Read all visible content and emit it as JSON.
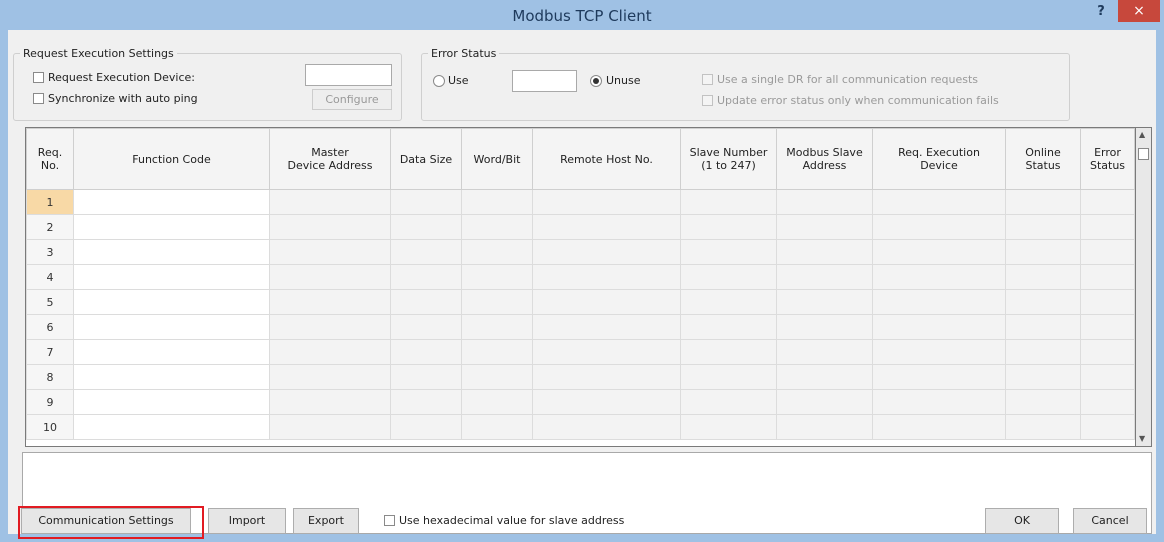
{
  "window": {
    "title": "Modbus TCP Client",
    "help": "?",
    "close": "×"
  },
  "request_settings": {
    "legend": "Request Execution Settings",
    "device_label": "Request Execution Device:",
    "auto_ping_label": "Synchronize with auto ping",
    "device_value": "",
    "configure_label": "Configure"
  },
  "error_status": {
    "legend": "Error Status",
    "use_label": "Use",
    "unuse_label": "Unuse",
    "selected": "Unuse",
    "value": "",
    "single_dr_label": "Use a single DR for all communication requests",
    "update_label": "Update error status only when communication fails"
  },
  "table": {
    "columns": [
      [
        "Req.",
        "No."
      ],
      [
        "Function Code"
      ],
      [
        "Master",
        "Device Address"
      ],
      [
        "Data Size"
      ],
      [
        "Word/Bit"
      ],
      [
        "Remote Host No."
      ],
      [
        "Slave Number",
        "(1 to 247)"
      ],
      [
        "Modbus Slave",
        "Address"
      ],
      [
        "Req. Execution",
        "Device"
      ],
      [
        "Online",
        "Status"
      ],
      [
        "Error",
        "Status"
      ]
    ],
    "rows": [
      "1",
      "2",
      "3",
      "4",
      "5",
      "6",
      "7",
      "8",
      "9",
      "10"
    ],
    "selected_row": "1"
  },
  "footer": {
    "comm_settings": "Communication Settings",
    "import": "Import",
    "export": "Export",
    "hex_label": "Use hexadecimal value for slave address",
    "ok": "OK",
    "cancel": "Cancel"
  },
  "colors": {
    "accent_red": "#e11b22",
    "title_bar": "#9fc1e4",
    "selected_row": "#f8d9a6"
  }
}
